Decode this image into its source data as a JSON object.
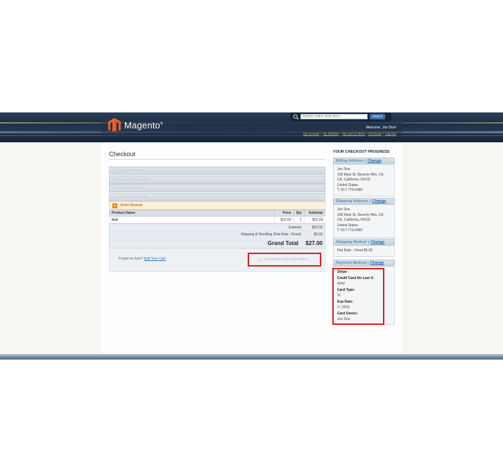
{
  "header": {
    "logo_text": "Magento",
    "logo_reg": "®",
    "search_placeholder": "Search entire store here...",
    "search_button": "Search",
    "welcome": "Welcome, Jon Doe!",
    "links": [
      "My Account",
      "My Wishlist",
      "My Cart (1 item)",
      "Checkout",
      "Log Out"
    ]
  },
  "page": {
    "title": "Checkout"
  },
  "steps": [
    {
      "num": "1",
      "label": "Billing Information"
    },
    {
      "num": "2",
      "label": "Shipping Information"
    },
    {
      "num": "3",
      "label": "Shipping Method"
    },
    {
      "num": "4",
      "label": "Payment Information"
    },
    {
      "num": "5",
      "label": "Order Review"
    }
  ],
  "review": {
    "columns": [
      "Product Name",
      "Price",
      "Qty",
      "Subtotal"
    ],
    "items": [
      {
        "name": "test",
        "price": "$22.00",
        "qty": "1",
        "subtotal": "$22.00"
      }
    ],
    "totals": {
      "subtotal_label": "Subtotal",
      "subtotal_value": "$22.00",
      "shipping_label": "Shipping & Handling (Flat Rate - Fixed)",
      "shipping_value": "$5.00",
      "grand_label": "Grand Total",
      "grand_value": "$27.00"
    },
    "forgot_text": "Forgot an Item?",
    "edit_cart": "Edit Your Cart",
    "submitting": "Submitting order information..."
  },
  "progress": {
    "title": "YOUR CHECKOUT PROGRESS",
    "change": "Change",
    "billing": {
      "title": "Billing Address",
      "lines": [
        "Jon Doe",
        "168 Main St, Beverly Hills, CA",
        "CA, California, 94103",
        "United States",
        "T: 917-779-0480"
      ]
    },
    "shipping": {
      "title": "Shipping Address",
      "lines": [
        "Jon Doe",
        "168 Main St, Beverly Hills, CA",
        "CA, California, 94103",
        "United States",
        "T: 917-779-0480"
      ]
    },
    "method": {
      "title": "Shipping Method",
      "line": "Flat Rate - Fixed $5.00"
    },
    "payment": {
      "title": "Payment Method",
      "method": "Stripe",
      "last4_label": "Credit Card No Last 4:",
      "last4": "4242",
      "type_label": "Card Type:",
      "type": "VI",
      "exp_label": "Exp Date:",
      "exp": "2 / 2015",
      "owner_label": "Card Owner:",
      "owner": "Jon Doe"
    }
  },
  "colors": {
    "header_dark": "#1d2f44",
    "accent_orange": "#f18200",
    "link_blue": "#1e6bb8",
    "highlight_red": "#e01b1b"
  }
}
